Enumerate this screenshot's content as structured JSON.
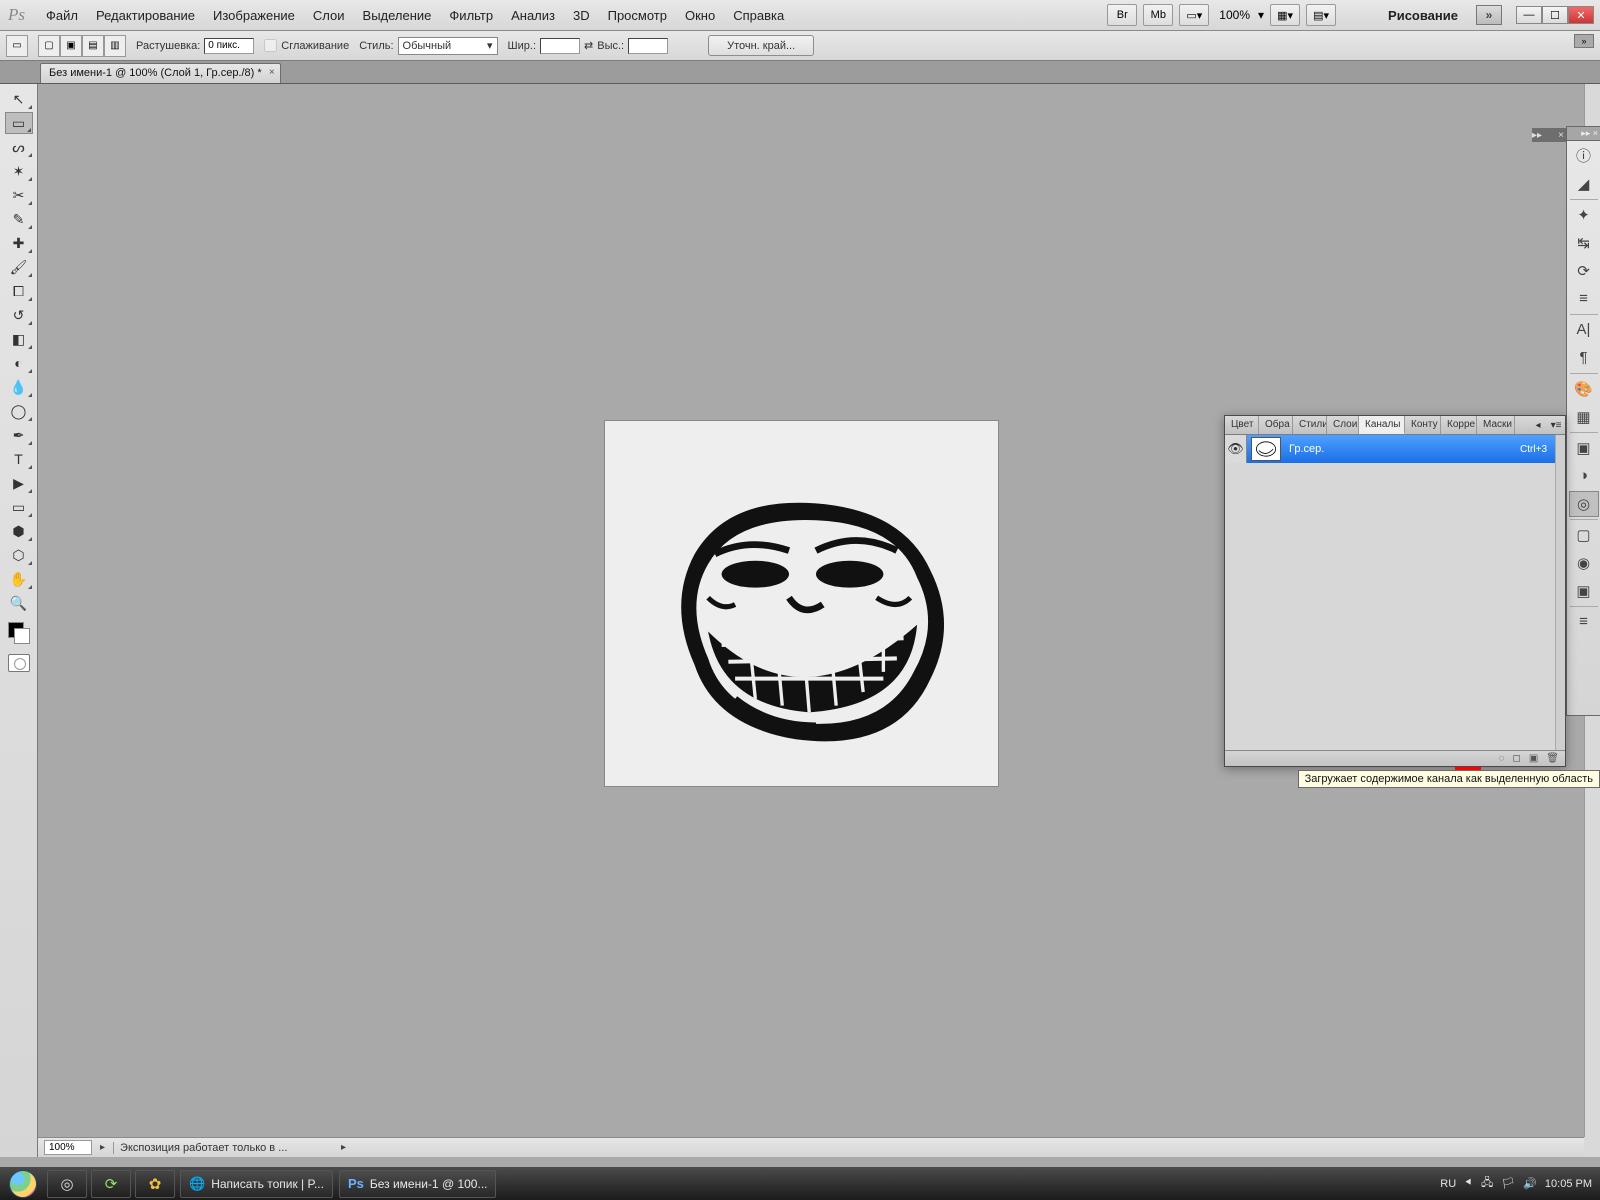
{
  "menu": {
    "items": [
      "Файл",
      "Редактирование",
      "Изображение",
      "Слои",
      "Выделение",
      "Фильтр",
      "Анализ",
      "3D",
      "Просмотр",
      "Окно",
      "Справка"
    ],
    "zoom": "100%",
    "workspace": "Рисование"
  },
  "options": {
    "feather_label": "Растушевка:",
    "feather_value": "0 пикс.",
    "antialias_label": "Сглаживание",
    "style_label": "Стиль:",
    "style_value": "Обычный",
    "width_label": "Шир.:",
    "height_label": "Выс.:",
    "refine": "Уточн. край..."
  },
  "doc": {
    "tab": "Без имени-1 @ 100% (Слой 1, Гр.сер./8) *"
  },
  "status": {
    "zoom": "100%",
    "info": "Экспозиция работает только в ..."
  },
  "panel": {
    "tabs": [
      "Цвет",
      "Обра",
      "Стили",
      "Слои",
      "Каналы",
      "Конту",
      "Корре",
      "Маски"
    ],
    "active_tab_index": 4,
    "channel": {
      "name": "Гр.сер.",
      "shortcut": "Ctrl+3"
    }
  },
  "tooltip": "Загружает содержимое канала как выделенную область",
  "taskbar": {
    "items": [
      {
        "icon": "🌐",
        "label": "Написать топик | P..."
      },
      {
        "icon": "Ps",
        "label": "Без имени-1 @ 100..."
      }
    ],
    "lang": "RU",
    "time": "10:05 PM"
  }
}
